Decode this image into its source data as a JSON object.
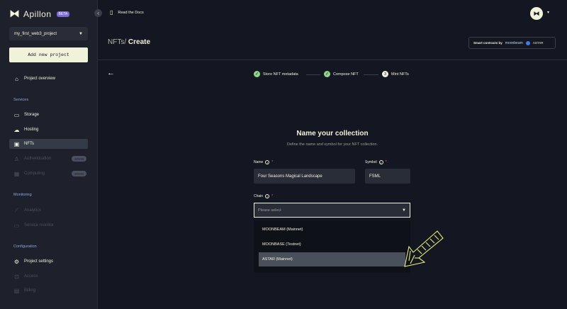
{
  "app": {
    "logo_text": "Apillon",
    "beta": "BETA"
  },
  "project": {
    "selected": "my_first_web3_project",
    "add_label": "Add new project"
  },
  "nav": {
    "overview": "Project overview",
    "services_title": "Services",
    "storage": "Storage",
    "hosting": "Hosting",
    "nfts": "NFTs",
    "authentication": "Authentication",
    "computing": "Computing",
    "soon": "SOON",
    "monitoring_title": "Monitoring",
    "analytics": "Analytics",
    "service_monitor": "Service monitor",
    "configuration_title": "Configuration",
    "project_settings": "Project settings",
    "access": "Access",
    "billing": "Billing"
  },
  "topbar": {
    "docs": "Read the Docs"
  },
  "header": {
    "title_prefix": "NFTs/",
    "title": "Create",
    "smart_label": "Smart contracts by",
    "moonbeam": "moonbeam",
    "astar": "ASTAR"
  },
  "steps": [
    {
      "label": "Store NFT metadata",
      "state": "done"
    },
    {
      "label": "Compose NFT",
      "state": "done"
    },
    {
      "label": "Mint NFTs",
      "number": "3",
      "state": "active"
    }
  ],
  "form": {
    "title": "Name your collection",
    "description": "Define the name and symbol for your NFT collection.",
    "name_label": "Name",
    "name_value": "Four Seasons Magical Landscape",
    "symbol_label": "Symbol",
    "symbol_value": "FSML",
    "chain_label": "Chain",
    "chain_placeholder": "Please select",
    "chain_options": [
      "MOONBEAM (Mainnet)",
      "MOONBASE (Testnet)",
      "ASTAR (Mainnet)"
    ],
    "highlighted_option": "ASTAR (Mainnet)"
  },
  "colors": {
    "bg": "#141721",
    "sidebar": "#1e212b",
    "accent": "#f0f2da",
    "success": "#8fd48a",
    "highlight_arrow": "#e6f07a"
  }
}
